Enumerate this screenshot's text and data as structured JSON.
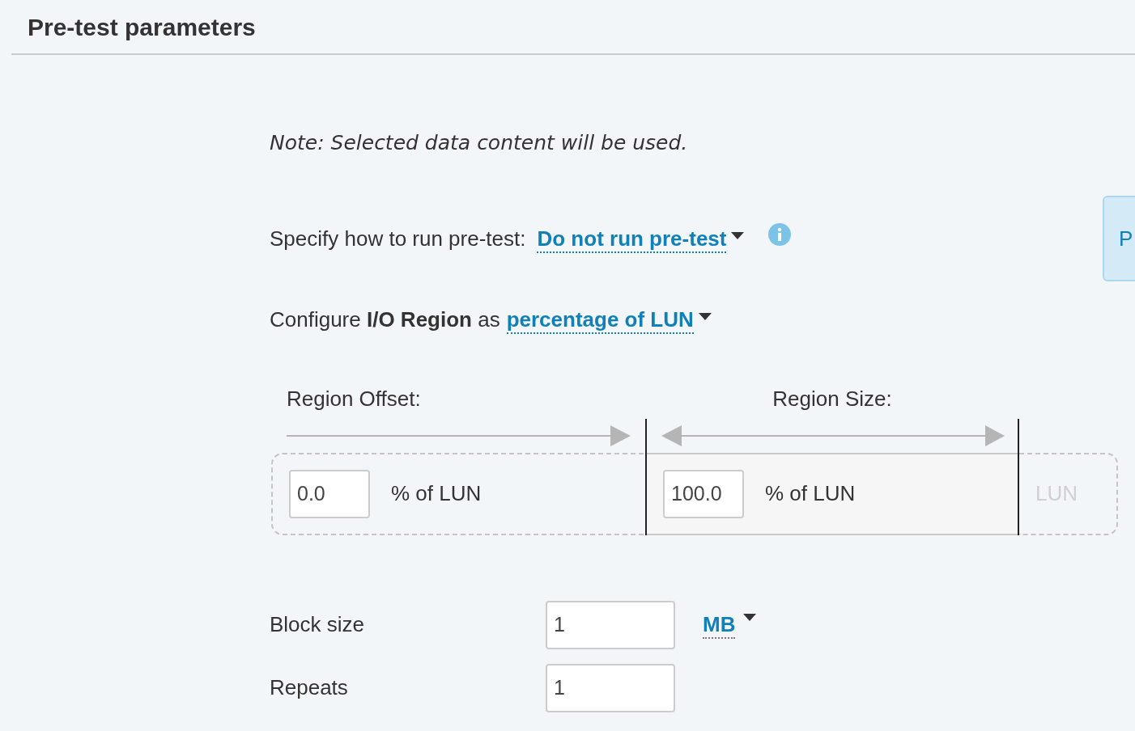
{
  "header": {
    "title": "Pre-test parameters"
  },
  "note": "Note: Selected data content will be used.",
  "pretest": {
    "label": "Specify how to run pre-test:",
    "value": "Do not run pre-test"
  },
  "io_region": {
    "label": "Configure **I/O Region** as",
    "value": "percentage of LUN"
  },
  "region_offset": {
    "label": "Region Offset:",
    "value": "0.0",
    "unit": "% of LUN"
  },
  "region_size": {
    "label": "Region Size:",
    "value": "100.0",
    "unit": "% of LUN"
  },
  "lun_label": "LUN",
  "block_size": {
    "label": "Block size",
    "value": "1",
    "unit": "MB"
  },
  "repeats": {
    "label": "Repeats",
    "value": "1"
  },
  "side_button": {
    "label": "P"
  }
}
